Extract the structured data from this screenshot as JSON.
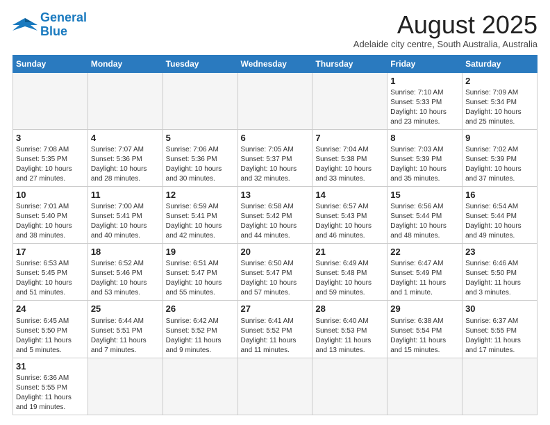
{
  "logo": {
    "general": "General",
    "blue": "Blue"
  },
  "title": "August 2025",
  "subtitle": "Adelaide city centre, South Australia, Australia",
  "days_of_week": [
    "Sunday",
    "Monday",
    "Tuesday",
    "Wednesday",
    "Thursday",
    "Friday",
    "Saturday"
  ],
  "weeks": [
    [
      {
        "day": null,
        "content": null
      },
      {
        "day": null,
        "content": null
      },
      {
        "day": null,
        "content": null
      },
      {
        "day": null,
        "content": null
      },
      {
        "day": null,
        "content": null
      },
      {
        "day": "1",
        "content": "Sunrise: 7:10 AM\nSunset: 5:33 PM\nDaylight: 10 hours and 23 minutes."
      },
      {
        "day": "2",
        "content": "Sunrise: 7:09 AM\nSunset: 5:34 PM\nDaylight: 10 hours and 25 minutes."
      }
    ],
    [
      {
        "day": "3",
        "content": "Sunrise: 7:08 AM\nSunset: 5:35 PM\nDaylight: 10 hours and 27 minutes."
      },
      {
        "day": "4",
        "content": "Sunrise: 7:07 AM\nSunset: 5:36 PM\nDaylight: 10 hours and 28 minutes."
      },
      {
        "day": "5",
        "content": "Sunrise: 7:06 AM\nSunset: 5:36 PM\nDaylight: 10 hours and 30 minutes."
      },
      {
        "day": "6",
        "content": "Sunrise: 7:05 AM\nSunset: 5:37 PM\nDaylight: 10 hours and 32 minutes."
      },
      {
        "day": "7",
        "content": "Sunrise: 7:04 AM\nSunset: 5:38 PM\nDaylight: 10 hours and 33 minutes."
      },
      {
        "day": "8",
        "content": "Sunrise: 7:03 AM\nSunset: 5:39 PM\nDaylight: 10 hours and 35 minutes."
      },
      {
        "day": "9",
        "content": "Sunrise: 7:02 AM\nSunset: 5:39 PM\nDaylight: 10 hours and 37 minutes."
      }
    ],
    [
      {
        "day": "10",
        "content": "Sunrise: 7:01 AM\nSunset: 5:40 PM\nDaylight: 10 hours and 38 minutes."
      },
      {
        "day": "11",
        "content": "Sunrise: 7:00 AM\nSunset: 5:41 PM\nDaylight: 10 hours and 40 minutes."
      },
      {
        "day": "12",
        "content": "Sunrise: 6:59 AM\nSunset: 5:41 PM\nDaylight: 10 hours and 42 minutes."
      },
      {
        "day": "13",
        "content": "Sunrise: 6:58 AM\nSunset: 5:42 PM\nDaylight: 10 hours and 44 minutes."
      },
      {
        "day": "14",
        "content": "Sunrise: 6:57 AM\nSunset: 5:43 PM\nDaylight: 10 hours and 46 minutes."
      },
      {
        "day": "15",
        "content": "Sunrise: 6:56 AM\nSunset: 5:44 PM\nDaylight: 10 hours and 48 minutes."
      },
      {
        "day": "16",
        "content": "Sunrise: 6:54 AM\nSunset: 5:44 PM\nDaylight: 10 hours and 49 minutes."
      }
    ],
    [
      {
        "day": "17",
        "content": "Sunrise: 6:53 AM\nSunset: 5:45 PM\nDaylight: 10 hours and 51 minutes."
      },
      {
        "day": "18",
        "content": "Sunrise: 6:52 AM\nSunset: 5:46 PM\nDaylight: 10 hours and 53 minutes."
      },
      {
        "day": "19",
        "content": "Sunrise: 6:51 AM\nSunset: 5:47 PM\nDaylight: 10 hours and 55 minutes."
      },
      {
        "day": "20",
        "content": "Sunrise: 6:50 AM\nSunset: 5:47 PM\nDaylight: 10 hours and 57 minutes."
      },
      {
        "day": "21",
        "content": "Sunrise: 6:49 AM\nSunset: 5:48 PM\nDaylight: 10 hours and 59 minutes."
      },
      {
        "day": "22",
        "content": "Sunrise: 6:47 AM\nSunset: 5:49 PM\nDaylight: 11 hours and 1 minute."
      },
      {
        "day": "23",
        "content": "Sunrise: 6:46 AM\nSunset: 5:50 PM\nDaylight: 11 hours and 3 minutes."
      }
    ],
    [
      {
        "day": "24",
        "content": "Sunrise: 6:45 AM\nSunset: 5:50 PM\nDaylight: 11 hours and 5 minutes."
      },
      {
        "day": "25",
        "content": "Sunrise: 6:44 AM\nSunset: 5:51 PM\nDaylight: 11 hours and 7 minutes."
      },
      {
        "day": "26",
        "content": "Sunrise: 6:42 AM\nSunset: 5:52 PM\nDaylight: 11 hours and 9 minutes."
      },
      {
        "day": "27",
        "content": "Sunrise: 6:41 AM\nSunset: 5:52 PM\nDaylight: 11 hours and 11 minutes."
      },
      {
        "day": "28",
        "content": "Sunrise: 6:40 AM\nSunset: 5:53 PM\nDaylight: 11 hours and 13 minutes."
      },
      {
        "day": "29",
        "content": "Sunrise: 6:38 AM\nSunset: 5:54 PM\nDaylight: 11 hours and 15 minutes."
      },
      {
        "day": "30",
        "content": "Sunrise: 6:37 AM\nSunset: 5:55 PM\nDaylight: 11 hours and 17 minutes."
      }
    ],
    [
      {
        "day": "31",
        "content": "Sunrise: 6:36 AM\nSunset: 5:55 PM\nDaylight: 11 hours and 19 minutes."
      },
      {
        "day": null,
        "content": null
      },
      {
        "day": null,
        "content": null
      },
      {
        "day": null,
        "content": null
      },
      {
        "day": null,
        "content": null
      },
      {
        "day": null,
        "content": null
      },
      {
        "day": null,
        "content": null
      }
    ]
  ]
}
